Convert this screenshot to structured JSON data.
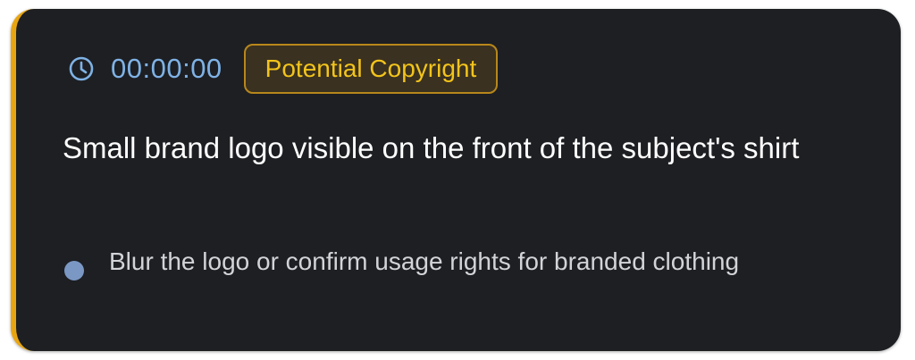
{
  "card": {
    "accent_color": "#e8a512",
    "timestamp": "00:00:00",
    "timestamp_icon": "clock-icon",
    "badge": {
      "label": "Potential Copyright",
      "color": "#f3c41b"
    },
    "title": "Small brand logo visible on the front of the subject's shirt",
    "recommendation": "Blur the logo or confirm usage rights for branded clothing",
    "bullet_color": "#7b98c4"
  }
}
